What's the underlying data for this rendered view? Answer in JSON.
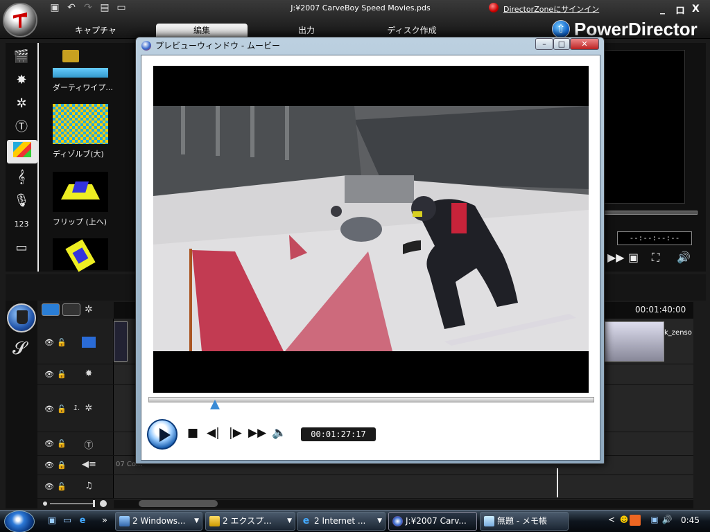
{
  "app": {
    "file_title": "J:¥2007 CarveBoy Speed Movies.pds",
    "signin_link": "DirectorZoneにサインイン",
    "brand": "PowerDirector",
    "window_minimize": "_",
    "window_restore": "ロ",
    "window_close": "X"
  },
  "main_tabs": [
    "キャプチャ",
    "編集",
    "出力",
    "ディスク作成"
  ],
  "library": {
    "items": [
      {
        "label": "ダーティワイプ..."
      },
      {
        "label": "ディゾルブ(大)"
      },
      {
        "label": "フリップ (上へ)"
      }
    ]
  },
  "right_panel": {
    "timecode": "--:--:--:--"
  },
  "timeline": {
    "ruler_time": "00:01:40:00",
    "clip_label": "k_zenso",
    "clip_text": "07 Co...",
    "track_number": "1."
  },
  "preview_window": {
    "title": "プレビューウィンドウ - ムービー",
    "timecode": "00:01:27:17",
    "seek_fraction": 0.15
  },
  "taskbar": {
    "buttons": [
      {
        "label": "2 Windows...",
        "arrow": "▼"
      },
      {
        "label": "2 エクスプ...",
        "arrow": "▼"
      },
      {
        "label": "2 Internet ...",
        "arrow": "▼"
      },
      {
        "label": "J:¥2007 Carv...",
        "arrow": ""
      },
      {
        "label": "無題 - メモ帳",
        "arrow": ""
      }
    ],
    "overflow": "»",
    "tray_expand": "<",
    "clock": "0:45"
  },
  "colors": {
    "accent_blue": "#3a8bd6",
    "flag_red": "#c83a52",
    "dark_bg": "#1b1b1b"
  }
}
